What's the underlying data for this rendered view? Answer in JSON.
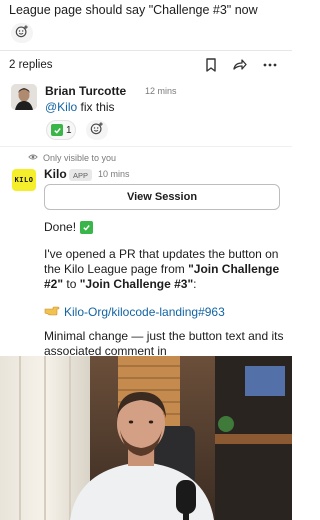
{
  "thread": {
    "top_text": "League page should say \"Challenge #3\" now",
    "replies_label": "2 replies"
  },
  "reply": {
    "author": "Brian Turcotte",
    "time": "12 mins",
    "mention": "@Kilo",
    "text": " fix this",
    "reaction_emoji": "white-check-mark",
    "reaction_count": "1"
  },
  "bot": {
    "visibility_note": "Only visible to you",
    "name": "Kilo",
    "badge": "APP",
    "time": "10 mins",
    "logo_text": "KILO",
    "view_session_label": "View Session",
    "done_text": "Done!",
    "para1_prefix": "I've opened a PR that updates the button on the Kilo League page from ",
    "old_label": "\"Join Challenge #2\"",
    "para1_mid": " to ",
    "new_label": "\"Join Challenge #3\"",
    "para1_suffix": ":",
    "pr_link": "Kilo-Org/kilocode-landing#963",
    "para2": "Minimal change — just the button text and its associated comment in"
  },
  "colors": {
    "link": "#1264a3",
    "kilo_yellow": "#f4ef2a",
    "check_green": "#39b54a"
  },
  "icons": [
    "add-reaction-icon",
    "bookmark-icon",
    "share-icon",
    "more-icon",
    "eye-icon",
    "check-mark-icon",
    "pointing-hand-icon"
  ]
}
